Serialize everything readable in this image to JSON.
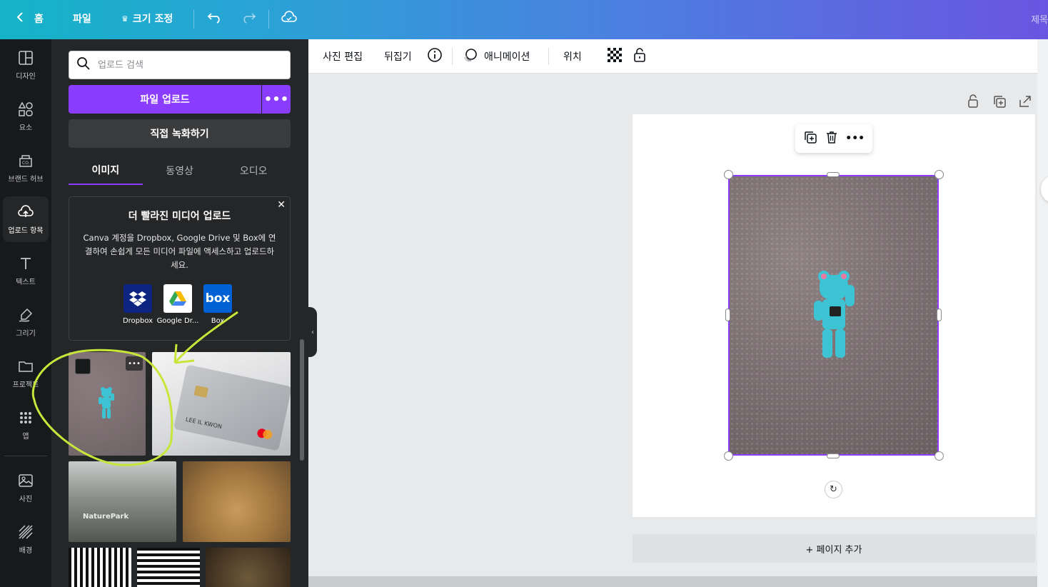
{
  "topbar": {
    "home_label": "홈",
    "file_label": "파일",
    "resize_label": "크기 조정",
    "title_fragment": "제목"
  },
  "rail": {
    "items": [
      {
        "label": "디자인",
        "icon": "layout-icon"
      },
      {
        "label": "요소",
        "icon": "shapes-icon"
      },
      {
        "label": "브랜드 허브",
        "icon": "brand-icon"
      },
      {
        "label": "업로드 항목",
        "icon": "cloud-upload-icon"
      },
      {
        "label": "텍스트",
        "icon": "text-icon"
      },
      {
        "label": "그리기",
        "icon": "draw-icon"
      },
      {
        "label": "프로젝트",
        "icon": "folder-icon"
      },
      {
        "label": "앱",
        "icon": "apps-grid-icon"
      },
      {
        "label": "사진",
        "icon": "photo-icon"
      },
      {
        "label": "배경",
        "icon": "background-icon"
      }
    ]
  },
  "panel": {
    "search_placeholder": "업로드 검색",
    "upload_button": "파일 업로드",
    "record_button": "직접 녹화하기",
    "tabs": [
      "이미지",
      "동영상",
      "오디오"
    ],
    "promo": {
      "title": "더 빨라진 미디어 업로드",
      "body": "Canva 계정을 Dropbox, Google Drive 및 Box에 연결하여 손쉽게 모든 미디어 파일에 액세스하고 업로드하세요.",
      "services": [
        "Dropbox",
        "Google Dr...",
        "Box"
      ]
    },
    "thumb_nature_text": "NaturePark",
    "thumb_card_text": "LEE IL KWON"
  },
  "toolbar": {
    "edit_photo": "사진 편집",
    "flip": "뒤집기",
    "animate": "애니메이션",
    "position": "위치"
  },
  "canvas": {
    "add_page": "+ 페이지 추가"
  },
  "colors": {
    "accent": "#8b3dff",
    "annotation": "#c8e63a",
    "figure": "#3cc4d4"
  }
}
